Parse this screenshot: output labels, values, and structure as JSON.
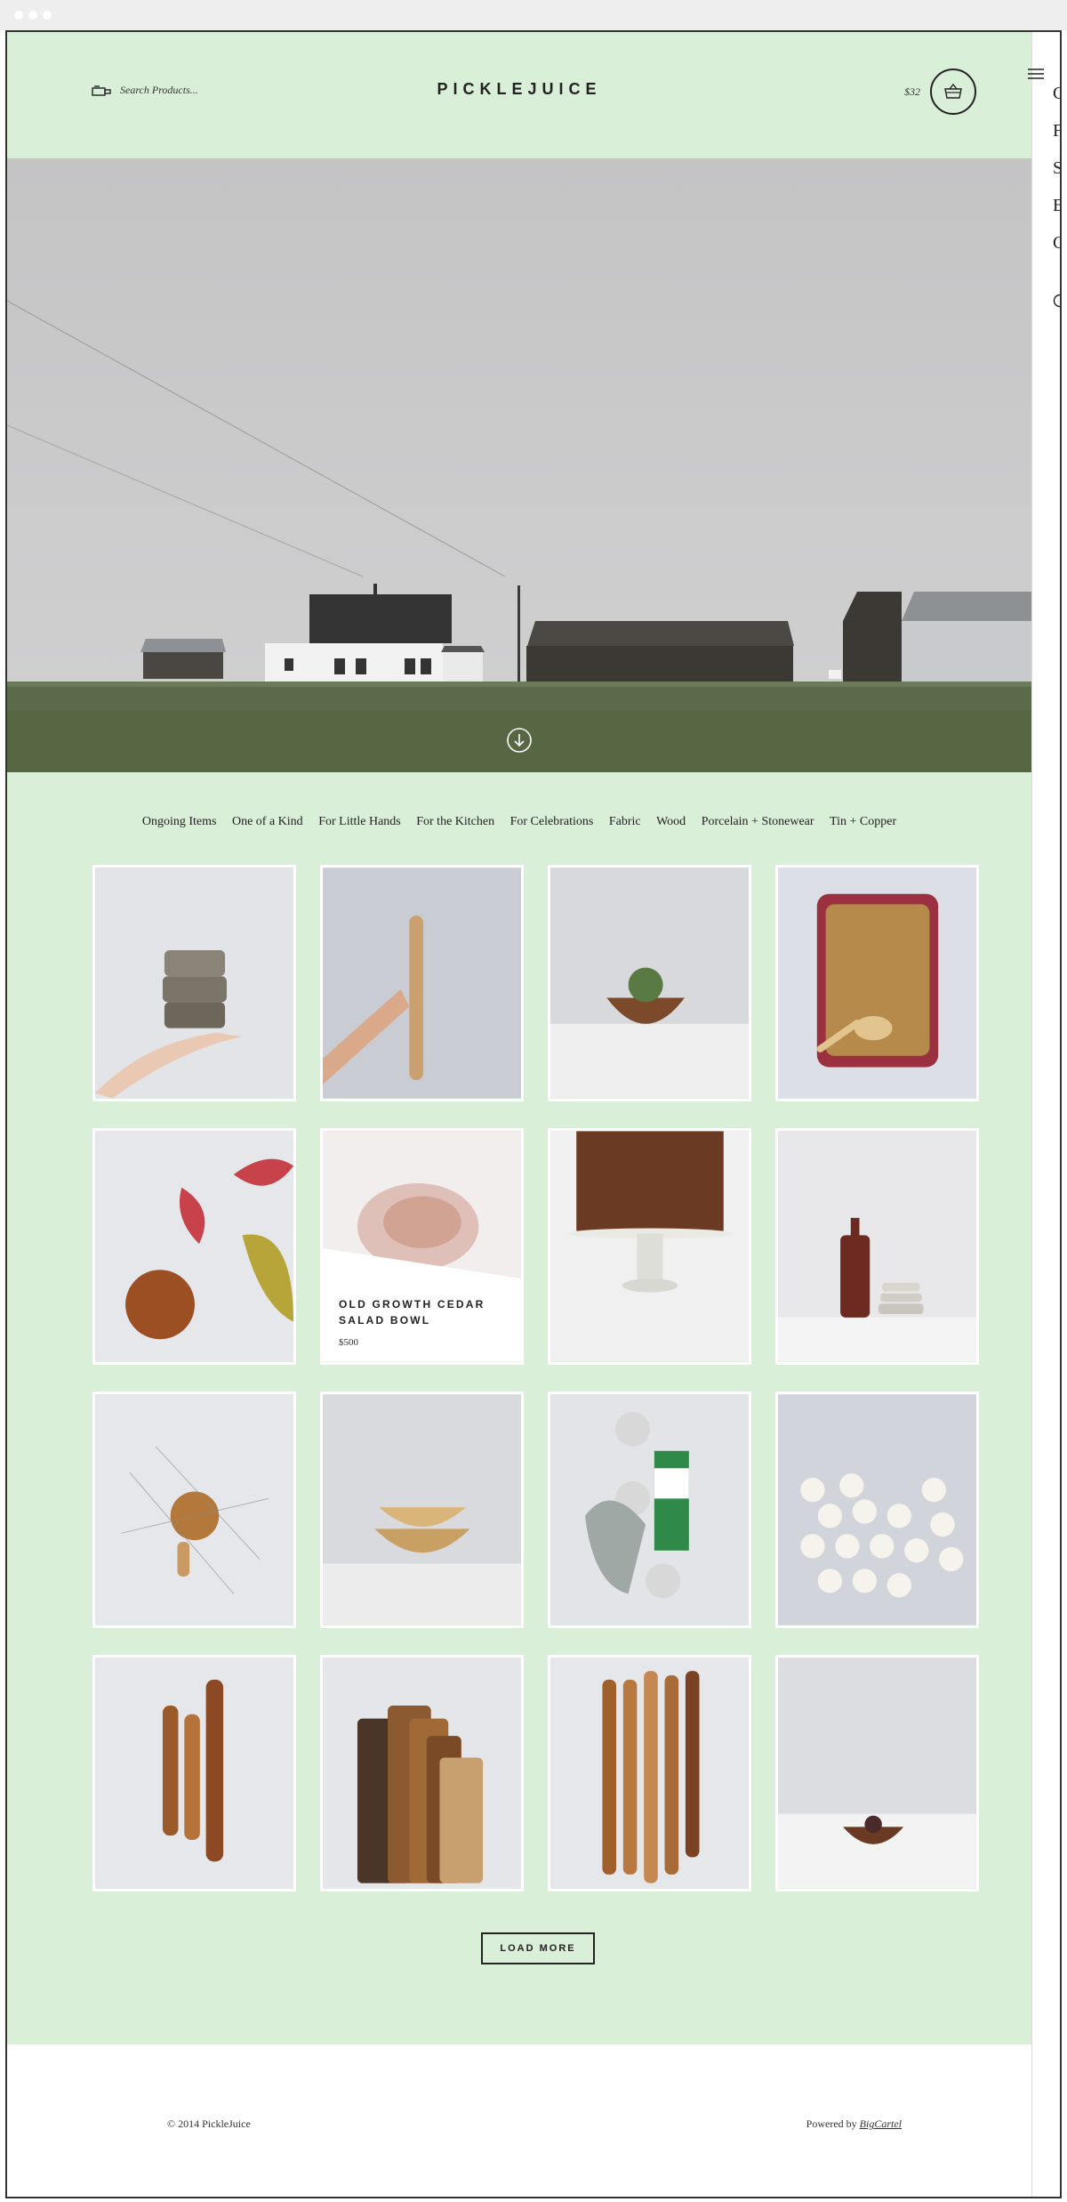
{
  "header": {
    "search_placeholder": "Search Products...",
    "logo": "PICKLEJUICE",
    "cart_total": "$32"
  },
  "categories": [
    "Ongoing Items",
    "One of a Kind",
    "For Little Hands",
    "For the Kitchen",
    "For Celebrations",
    "Fabric",
    "Wood",
    "Porcelain + Stonewear",
    "Tin + Copper"
  ],
  "products": {
    "hover_title": "OLD GROWTH CEDAR SALAD BOWL",
    "hover_price": "$500"
  },
  "load_more": "LOAD MORE",
  "footer": {
    "copyright": "© 2014 PickleJuice",
    "powered_prefix": "Powered by",
    "powered_link": "BigCartel"
  },
  "side_menu_letters": [
    "C",
    "F",
    "S",
    "B",
    "C"
  ],
  "colors": {
    "site_background": "#d9efd8",
    "text": "#222222",
    "tile_border": "#ffffff"
  },
  "icons": [
    "search-icon",
    "basket-icon",
    "arrow-down-icon",
    "hamburger-icon",
    "pointer-cursor-icon"
  ]
}
